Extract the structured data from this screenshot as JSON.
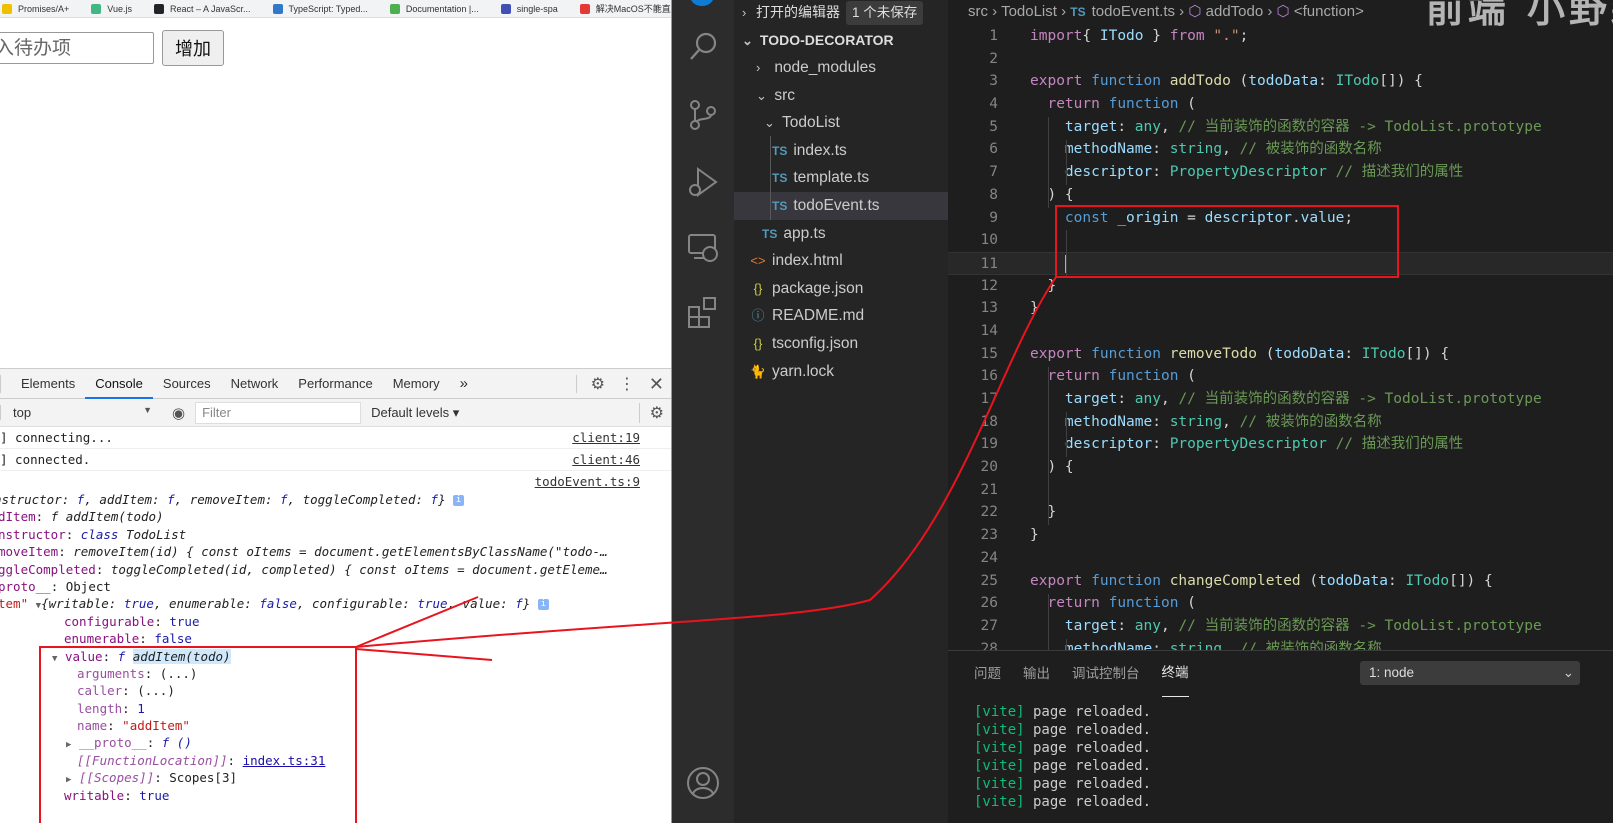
{
  "browser": {
    "bookmarks": [
      {
        "label": "Promises/A+",
        "icon": "promises-icon",
        "color": "#f0c000"
      },
      {
        "label": "Vue.js",
        "icon": "vue-icon",
        "color": "#41b883"
      },
      {
        "label": "React – A JavaScr...",
        "icon": "react-icon",
        "color": "#20232a"
      },
      {
        "label": "TypeScript: Typed...",
        "icon": "typescript-icon",
        "color": "#3178c6"
      },
      {
        "label": "Documentation |...",
        "icon": "mongodb-icon",
        "color": "#4caf50"
      },
      {
        "label": "single-spa",
        "icon": "single-spa-icon",
        "color": "#3f51b5"
      },
      {
        "label": "解决MacOS不能直...",
        "icon": "csdn-icon",
        "color": "#e53935"
      }
    ],
    "more_bookmarks": "»",
    "page": {
      "input_placeholder": "入待办项",
      "add_button": "增加"
    },
    "devtools": {
      "tabs": [
        "Elements",
        "Console",
        "Sources",
        "Network",
        "Performance",
        "Memory"
      ],
      "active_tab": "Console",
      "more_tabs": "»",
      "context": "top",
      "filter_placeholder": "Filter",
      "levels": "Default levels ▾",
      "messages": [
        {
          "text": "] connecting...",
          "source": "client:19"
        },
        {
          "text": "] connected.",
          "source": "client:46"
        }
      ],
      "object_source": "todoEvent.ts:9",
      "object_lines": {
        "summary": {
          "pre": "nstructor: ",
          "f1": "f",
          "mid1": ", addItem: ",
          "f2": "f",
          "mid2": ", removeItem: ",
          "f3": "f",
          "mid3": ", toggleCompleted: ",
          "f4": "f",
          "post": "}"
        },
        "addItem": {
          "key": "dItem",
          "val": "f addItem(todo)"
        },
        "constructor": {
          "key": "nstructor",
          "kw": "class",
          "val": "TodoList"
        },
        "removeItem": {
          "key": "moveItem",
          "val": "removeItem(id) { const oItems = document.getElementsByClassName(\"todo-…"
        },
        "toggleCompleted": {
          "key": "ggleCompleted",
          "val": "toggleCompleted(id, completed) { const oItems = document.getEleme…"
        },
        "proto": {
          "key": "proto__",
          "val": "Object"
        },
        "descriptor": {
          "key": "tem\"",
          "writable": "true",
          "enumerable": "false",
          "configurable": "true",
          "value": "f"
        },
        "configurable": "true",
        "enumerable": "false",
        "value_fn": "addItem(todo)",
        "arguments": "(...)",
        "caller": "(...)",
        "length": "1",
        "name": "\"addItem\"",
        "fn_proto": "f ()",
        "function_location": "index.ts:31",
        "scopes": "Scopes[3]",
        "writable": "true"
      }
    }
  },
  "vscode": {
    "explorer": {
      "open_editors": "打开的编辑器",
      "unsaved_badge": "1 个未保存",
      "project": "TODO-DECORATOR",
      "tree": [
        {
          "label": "node_modules",
          "type": "folder-collapsed",
          "depth": 1
        },
        {
          "label": "src",
          "type": "folder-open",
          "depth": 1
        },
        {
          "label": "TodoList",
          "type": "folder-open",
          "depth": 2
        },
        {
          "label": "index.ts",
          "type": "ts",
          "depth": 3
        },
        {
          "label": "template.ts",
          "type": "ts",
          "depth": 3
        },
        {
          "label": "todoEvent.ts",
          "type": "ts",
          "depth": 3,
          "selected": true
        },
        {
          "label": "app.ts",
          "type": "ts",
          "depth": 2
        },
        {
          "label": "index.html",
          "type": "html",
          "depth": 1
        },
        {
          "label": "package.json",
          "type": "json",
          "depth": 1
        },
        {
          "label": "README.md",
          "type": "info",
          "depth": 1
        },
        {
          "label": "tsconfig.json",
          "type": "json",
          "depth": 1
        },
        {
          "label": "yarn.lock",
          "type": "yarn",
          "depth": 1
        }
      ]
    },
    "breadcrumb": [
      "src",
      "TodoList",
      "todoEvent.ts",
      "addTodo",
      "<function>"
    ],
    "overlay_text": "前端 小野森",
    "code": [
      {
        "n": "1",
        "t": [
          [
            "c-kw",
            "import"
          ],
          [
            "",
            "{ "
          ],
          [
            "c-var",
            "ITodo"
          ],
          [
            "",
            " } "
          ],
          [
            "c-kw",
            "from"
          ],
          [
            "",
            " "
          ],
          [
            "c-str",
            "\".\""
          ],
          [
            "",
            ";"
          ]
        ]
      },
      {
        "n": "2",
        "t": []
      },
      {
        "n": "3",
        "t": [
          [
            "c-kw",
            "export"
          ],
          [
            "",
            " "
          ],
          [
            "c-fn",
            "function"
          ],
          [
            "",
            " "
          ],
          [
            "c-name",
            "addTodo"
          ],
          [
            "",
            " ("
          ],
          [
            "c-var",
            "todoData"
          ],
          [
            "",
            ": "
          ],
          [
            "c-type",
            "ITodo"
          ],
          [
            "",
            "[]) {"
          ]
        ]
      },
      {
        "n": "4",
        "t": [
          [
            "",
            "  "
          ],
          [
            "c-kw",
            "return"
          ],
          [
            "",
            " "
          ],
          [
            "c-fn",
            "function"
          ],
          [
            "",
            " ("
          ]
        ]
      },
      {
        "n": "5",
        "t": [
          [
            "",
            "    "
          ],
          [
            "c-var",
            "target"
          ],
          [
            "",
            ": "
          ],
          [
            "c-type",
            "any"
          ],
          [
            "",
            ", "
          ],
          [
            "c-cmt",
            "// 当前装饰的函数的容器 -> TodoList.prototype"
          ]
        ]
      },
      {
        "n": "6",
        "t": [
          [
            "",
            "    "
          ],
          [
            "c-var",
            "methodName"
          ],
          [
            "",
            ": "
          ],
          [
            "c-type",
            "string"
          ],
          [
            "",
            ", "
          ],
          [
            "c-cmt",
            "// 被装饰的函数名称"
          ]
        ]
      },
      {
        "n": "7",
        "t": [
          [
            "",
            "    "
          ],
          [
            "c-var",
            "descriptor"
          ],
          [
            "",
            ": "
          ],
          [
            "c-type",
            "PropertyDescriptor"
          ],
          [
            "",
            " "
          ],
          [
            "c-cmt",
            "// 描述我们的属性"
          ]
        ]
      },
      {
        "n": "8",
        "t": [
          [
            "",
            "  ) {"
          ]
        ]
      },
      {
        "n": "9",
        "t": [
          [
            "",
            "    "
          ],
          [
            "c-const",
            "const"
          ],
          [
            "",
            " "
          ],
          [
            "c-var",
            "_origin"
          ],
          [
            "",
            " = "
          ],
          [
            "c-var",
            "descriptor"
          ],
          [
            "",
            "."
          ],
          [
            "c-var",
            "value"
          ],
          [
            "",
            ";"
          ]
        ]
      },
      {
        "n": "10",
        "t": []
      },
      {
        "n": "11",
        "t": [],
        "cursor": true
      },
      {
        "n": "12",
        "t": [
          [
            "",
            "  }"
          ]
        ]
      },
      {
        "n": "13",
        "t": [
          [
            "",
            "}"
          ]
        ]
      },
      {
        "n": "14",
        "t": []
      },
      {
        "n": "15",
        "t": [
          [
            "c-kw",
            "export"
          ],
          [
            "",
            " "
          ],
          [
            "c-fn",
            "function"
          ],
          [
            "",
            " "
          ],
          [
            "c-name",
            "removeTodo"
          ],
          [
            "",
            " ("
          ],
          [
            "c-var",
            "todoData"
          ],
          [
            "",
            ": "
          ],
          [
            "c-type",
            "ITodo"
          ],
          [
            "",
            "[]) {"
          ]
        ]
      },
      {
        "n": "16",
        "t": [
          [
            "",
            "  "
          ],
          [
            "c-kw",
            "return"
          ],
          [
            "",
            " "
          ],
          [
            "c-fn",
            "function"
          ],
          [
            "",
            " ("
          ]
        ]
      },
      {
        "n": "17",
        "t": [
          [
            "",
            "    "
          ],
          [
            "c-var",
            "target"
          ],
          [
            "",
            ": "
          ],
          [
            "c-type",
            "any"
          ],
          [
            "",
            ", "
          ],
          [
            "c-cmt",
            "// 当前装饰的函数的容器 -> TodoList.prototype"
          ]
        ]
      },
      {
        "n": "18",
        "t": [
          [
            "",
            "    "
          ],
          [
            "c-var",
            "methodName"
          ],
          [
            "",
            ": "
          ],
          [
            "c-type",
            "string"
          ],
          [
            "",
            ", "
          ],
          [
            "c-cmt",
            "// 被装饰的函数名称"
          ]
        ]
      },
      {
        "n": "19",
        "t": [
          [
            "",
            "    "
          ],
          [
            "c-var",
            "descriptor"
          ],
          [
            "",
            ": "
          ],
          [
            "c-type",
            "PropertyDescriptor"
          ],
          [
            "",
            " "
          ],
          [
            "c-cmt",
            "// 描述我们的属性"
          ]
        ]
      },
      {
        "n": "20",
        "t": [
          [
            "",
            "  ) {"
          ]
        ]
      },
      {
        "n": "21",
        "t": []
      },
      {
        "n": "22",
        "t": [
          [
            "",
            "  }"
          ]
        ]
      },
      {
        "n": "23",
        "t": [
          [
            "",
            "}"
          ]
        ]
      },
      {
        "n": "24",
        "t": []
      },
      {
        "n": "25",
        "t": [
          [
            "c-kw",
            "export"
          ],
          [
            "",
            " "
          ],
          [
            "c-fn",
            "function"
          ],
          [
            "",
            " "
          ],
          [
            "c-name",
            "changeCompleted"
          ],
          [
            "",
            " ("
          ],
          [
            "c-var",
            "todoData"
          ],
          [
            "",
            ": "
          ],
          [
            "c-type",
            "ITodo"
          ],
          [
            "",
            "[]) {"
          ]
        ]
      },
      {
        "n": "26",
        "t": [
          [
            "",
            "  "
          ],
          [
            "c-kw",
            "return"
          ],
          [
            "",
            " "
          ],
          [
            "c-fn",
            "function"
          ],
          [
            "",
            " ("
          ]
        ]
      },
      {
        "n": "27",
        "t": [
          [
            "",
            "    "
          ],
          [
            "c-var",
            "target"
          ],
          [
            "",
            ": "
          ],
          [
            "c-type",
            "any"
          ],
          [
            "",
            ", "
          ],
          [
            "c-cmt",
            "// 当前装饰的函数的容器 -> TodoList.prototype"
          ]
        ]
      },
      {
        "n": "28",
        "t": [
          [
            "",
            "    "
          ],
          [
            "c-var",
            "methodName"
          ],
          [
            "",
            ": "
          ],
          [
            "c-type",
            "string"
          ],
          [
            "",
            ", "
          ],
          [
            "c-cmt",
            "// 被装饰的函数名称"
          ]
        ]
      }
    ],
    "panel": {
      "tabs": [
        "问题",
        "输出",
        "调试控制台",
        "终端"
      ],
      "active_tab": "终端",
      "terminal_select": "1: node",
      "terminal_lines": [
        {
          "tag": "[vite]",
          "text": " page reloaded."
        },
        {
          "tag": "[vite]",
          "text": " page reloaded."
        },
        {
          "tag": "[vite]",
          "text": " page reloaded."
        },
        {
          "tag": "[vite]",
          "text": " page reloaded."
        },
        {
          "tag": "[vite]",
          "text": " page reloaded."
        },
        {
          "tag": "[vite]",
          "text": " page reloaded."
        }
      ]
    }
  },
  "annotation_color": "#e8141e"
}
